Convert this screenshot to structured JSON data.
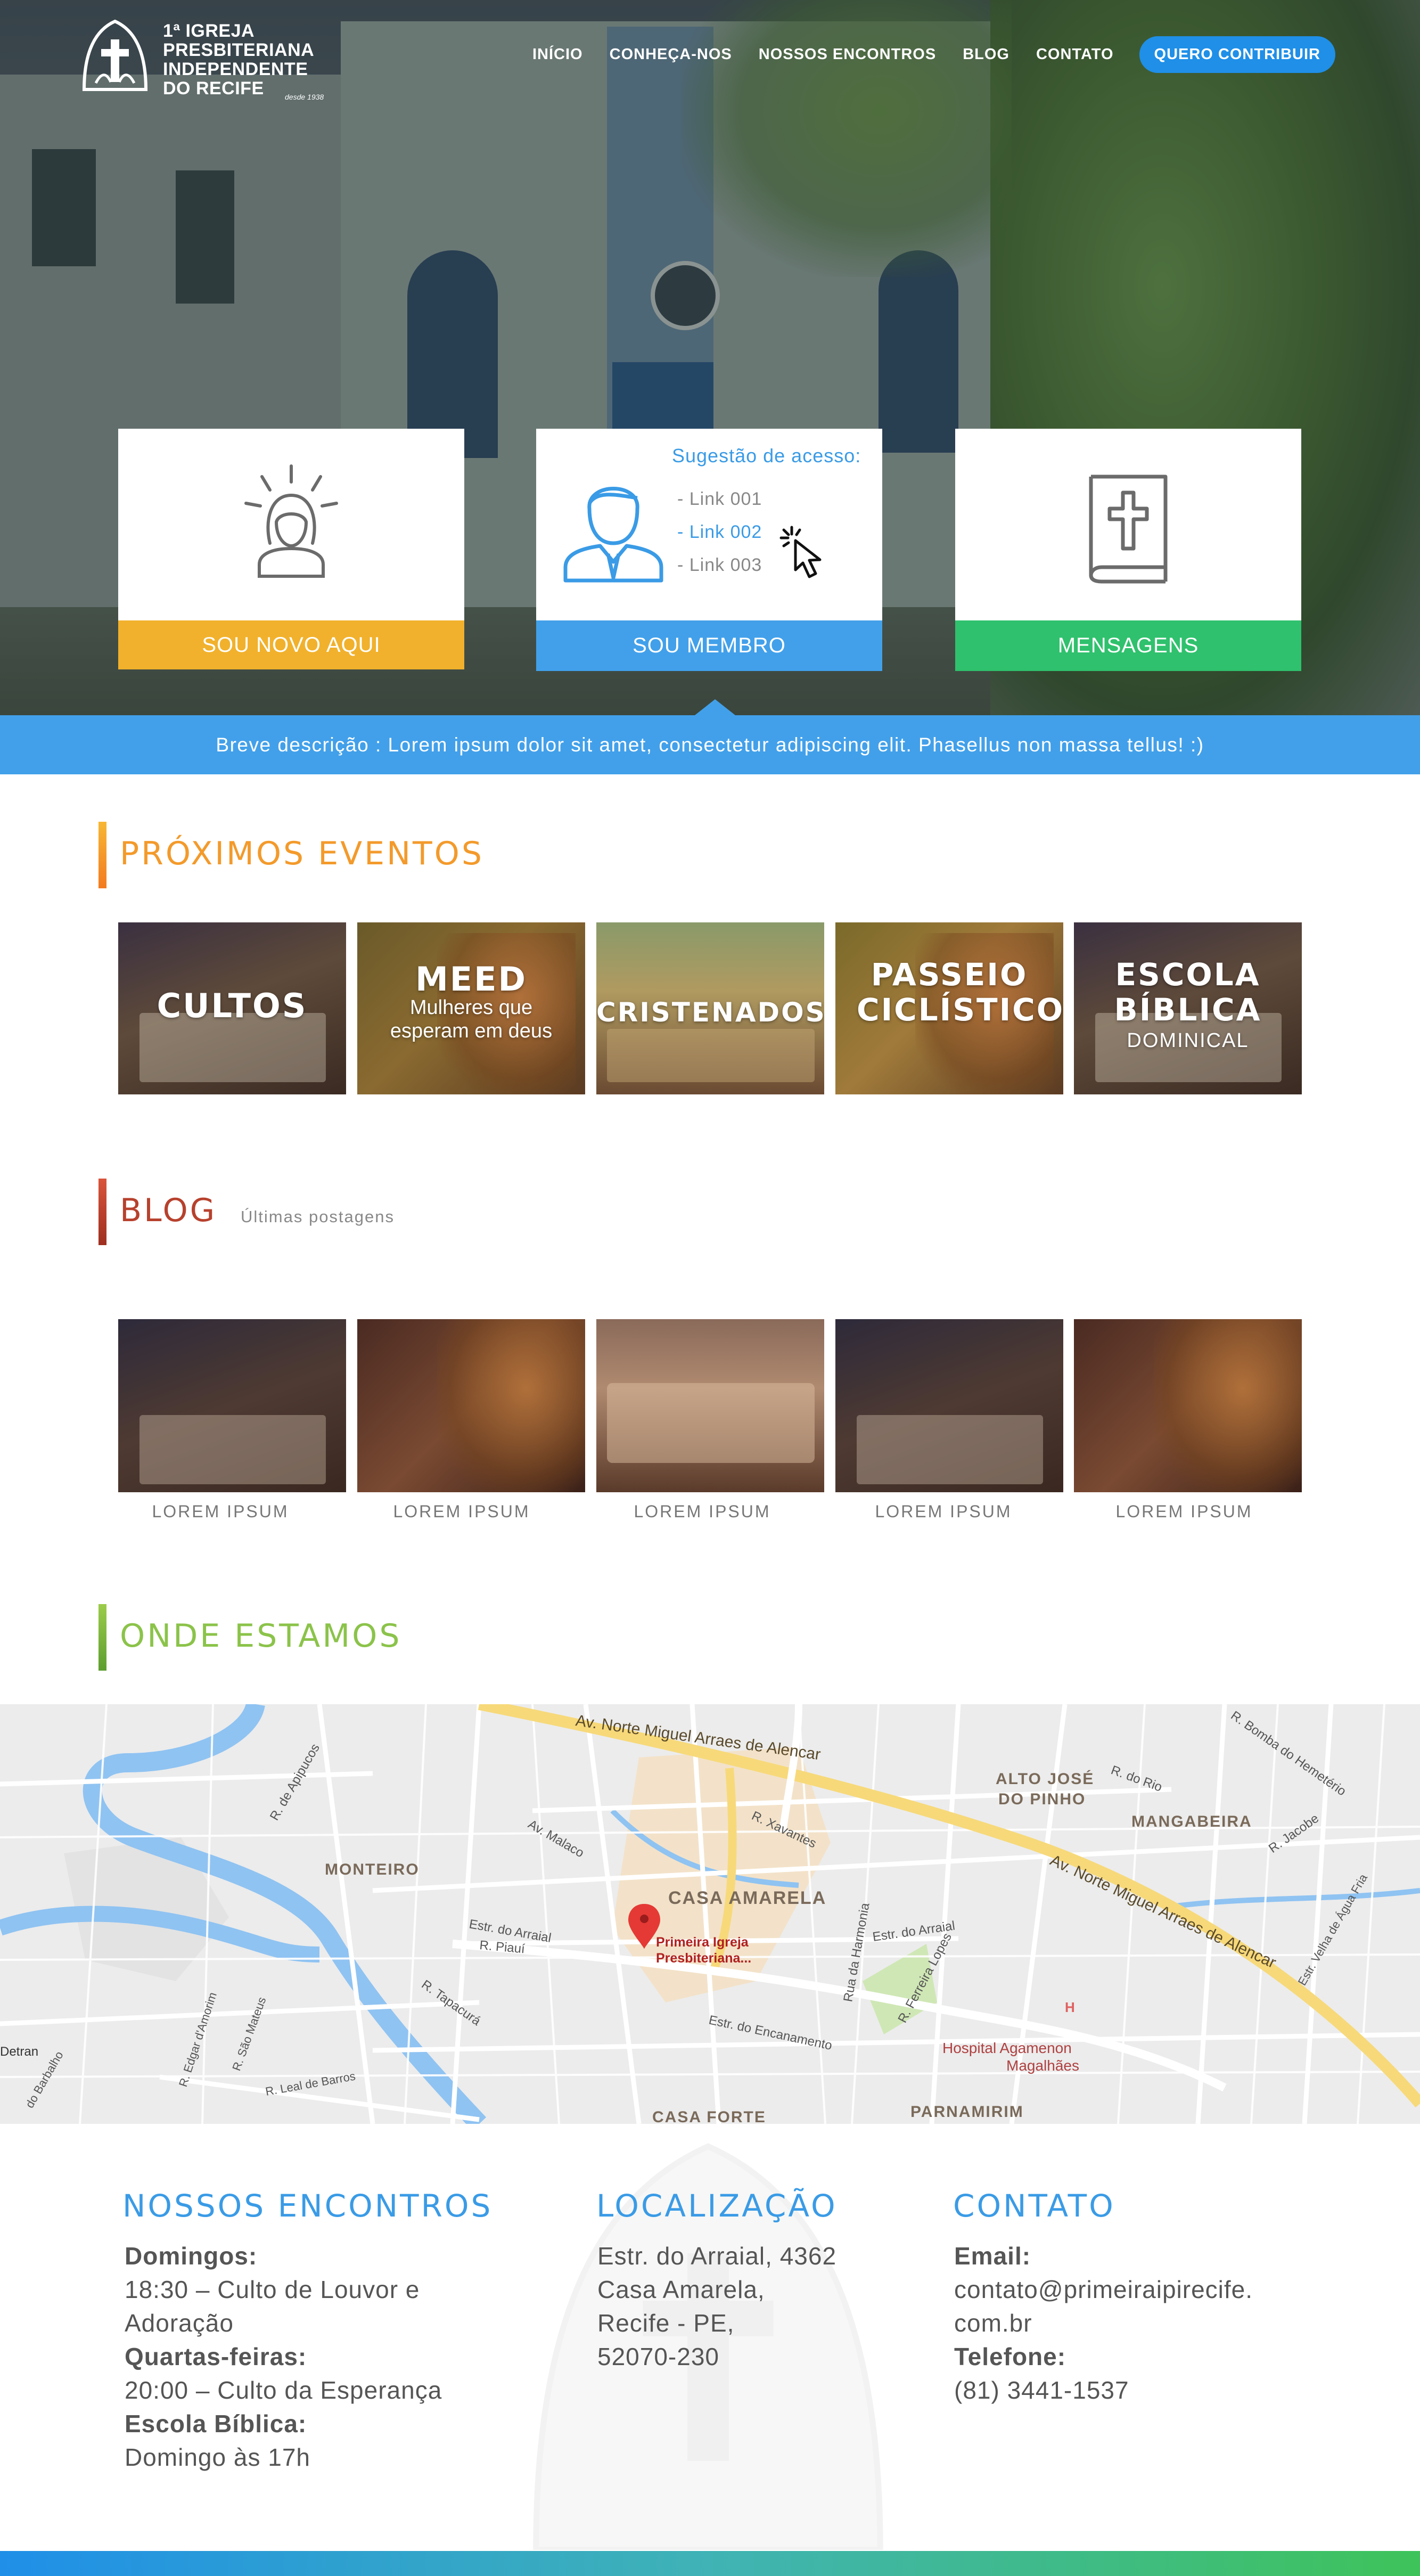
{
  "header": {
    "logo_lines": [
      "1ª IGREJA",
      "PRESBITERIANA",
      "INDEPENDENTE",
      "DO RECIFE"
    ],
    "logo_since": "desde 1938",
    "nav": [
      "INÍCIO",
      "CONHEÇA-NOS",
      "NOSSOS ENCONTROS",
      "BLOG",
      "CONTATO"
    ],
    "cta": "QUERO CONTRIBUIR"
  },
  "cards": {
    "novo": {
      "label": "SOU NOVO AQUI",
      "icon": "person-light-icon"
    },
    "membro": {
      "label": "SOU MEMBRO",
      "icon": "member-icon",
      "suggest_title": "Sugestão de acesso:",
      "links": [
        "- Link 001",
        "- Link 002",
        "- Link 003"
      ],
      "active_link_index": 1
    },
    "mensagens": {
      "label": "MENSAGENS",
      "icon": "bible-icon"
    }
  },
  "description": "Breve descrição : Lorem ipsum dolor sit amet, consectetur adipiscing elit. Phasellus non massa tellus! :)",
  "events": {
    "title": "PRÓXIMOS EVENTOS",
    "items": [
      {
        "title": "CULTOS",
        "subtitle": ""
      },
      {
        "title": "MEED",
        "subtitle": "Mulheres que esperam em deus"
      },
      {
        "title": "CRISTENADOS",
        "subtitle": ""
      },
      {
        "title": "PASSEIO CICLÍSTICO",
        "subtitle": ""
      },
      {
        "title": "ESCOLA BÍBLICA",
        "subtitle": "DOMINICAL"
      }
    ]
  },
  "blog": {
    "title": "BLOG",
    "subtitle": "Últimas postagens",
    "posts": [
      "LOREM IPSUM",
      "LOREM IPSUM",
      "LOREM IPSUM",
      "LOREM IPSUM",
      "LOREM IPSUM"
    ]
  },
  "location": {
    "title": "ONDE ESTAMOS",
    "map_labels": {
      "road_main": "Av. Norte Miguel Arraes de Alencar",
      "road_main2": "Av. Norte Miguel Arraes de Alencar",
      "monteiro": "MONTEIRO",
      "casa_amarela": "CASA AMARELA",
      "alto_jose": "ALTO JOSÉ DO PINHO",
      "mangabeira": "MANGABEIRA",
      "parnamirim": "PARNAMIRIM",
      "casa_forte": "CASA FORTE",
      "pin": "Primeira Igreja Presbiteriana...",
      "hospital": "Hospital Agamenon Magalhães",
      "arraial": "Estr. do Arraial",
      "encanamento": "Estr. do Encanamento",
      "detran": "Detran",
      "apipucos": "R. de Apipucos",
      "malaco": "Av. Malaco",
      "xavantes": "R. Xavantes",
      "harmonia": "Rua da Harmonia",
      "ferreira": "R. Ferreira Lopes",
      "rio": "R. do Rio",
      "jacobe": "R. Jacobe",
      "tapacura": "R. Tapacurá",
      "piaui": "R. Piauí",
      "sao_mateus": "R. São Mateus",
      "leal": "R. Leal de Barros",
      "edgar": "R. Edgar d'Amorim",
      "barbalho": "do Barbalho",
      "bomba": "R. Bomba do Hemetério",
      "velha": "Estr. Velha de Água Fria"
    }
  },
  "footer": {
    "encontros": {
      "title": "NOSSOS ENCONTROS",
      "lines": [
        {
          "bold": "Domingos:",
          "text": "18:30 – Culto de Louvor e Adoração"
        },
        {
          "bold": "Quartas-feiras:",
          "text": "20:00 – Culto da Esperança"
        },
        {
          "bold": "Escola Bíblica:",
          "text": "Domingo às 17h"
        }
      ]
    },
    "localizacao": {
      "title": "LOCALIZAÇÃO",
      "lines": [
        "Estr. do Arraial, 4362",
        "Casa Amarela,",
        "Recife - PE,",
        "52070-230"
      ]
    },
    "contato": {
      "title": "CONTATO",
      "email_label": "Email:",
      "email_line1": "contato@primeiraipirecife.",
      "email_line2": "com.br",
      "phone_label": "Telefone:",
      "phone": "(81) 3441-1537"
    }
  },
  "colors": {
    "blue": "#42a0ea",
    "yellow": "#f1b12c",
    "green": "#2fc16d",
    "orange": "#f39a2b",
    "red": "#b7412d",
    "lime": "#8bc34a"
  }
}
